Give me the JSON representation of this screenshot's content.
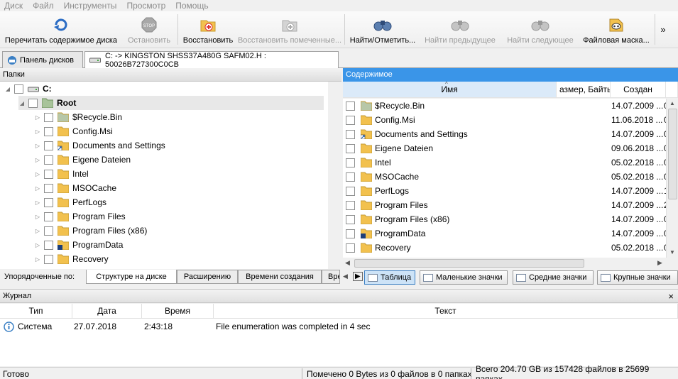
{
  "menu": [
    "Диск",
    "Файл",
    "Инструменты",
    "Просмотр",
    "Помощь"
  ],
  "toolbar": {
    "rescan": "Перечитать содержимое диска",
    "stop": "Остановить",
    "restore": "Восстановить",
    "restore_marked": "Восстановить помеченные...",
    "find_mark": "Найти/Отметить...",
    "find_prev": "Найти предыдущее",
    "find_next": "Найти следующее",
    "file_mask": "Файловая маска...",
    "more": "»"
  },
  "tabs": {
    "panel": "Панель дисков",
    "drive": "C: -> KINGSTON SHSS37A480G SAFM02.H : 50026B727300C0CB"
  },
  "left": {
    "header": "Папки",
    "drive": "C:",
    "root": "Root",
    "folders": [
      "$Recycle.Bin",
      "Config.Msi",
      "Documents and Settings",
      "Eigene Dateien",
      "Intel",
      "MSOCache",
      "PerfLogs",
      "Program Files",
      "Program Files (x86)",
      "ProgramData",
      "Recovery"
    ]
  },
  "right": {
    "header": "Содержимое",
    "columns": {
      "name": "Имя",
      "size": "азмер, Байты",
      "created": "Создан"
    },
    "rows": [
      {
        "name": "$Recycle.Bin",
        "date": "14.07.2009 ...",
        "x": "0"
      },
      {
        "name": "Config.Msi",
        "date": "11.06.2018 ...",
        "x": "0"
      },
      {
        "name": "Documents and Settings",
        "date": "14.07.2009 ...",
        "x": "0"
      },
      {
        "name": "Eigene Dateien",
        "date": "09.06.2018 ...",
        "x": "0"
      },
      {
        "name": "Intel",
        "date": "05.02.2018 ...",
        "x": "0"
      },
      {
        "name": "MSOCache",
        "date": "05.02.2018 ...",
        "x": "0"
      },
      {
        "name": "PerfLogs",
        "date": "14.07.2009 ...",
        "x": "1"
      },
      {
        "name": "Program Files",
        "date": "14.07.2009 ...",
        "x": "2"
      },
      {
        "name": "Program Files (x86)",
        "date": "14.07.2009 ...",
        "x": "0"
      },
      {
        "name": "ProgramData",
        "date": "14.07.2009 ...",
        "x": "0"
      },
      {
        "name": "Recovery",
        "date": "05.02.2018 ...",
        "x": "0"
      }
    ]
  },
  "sort": {
    "label": "Упорядоченные по:",
    "tabs": [
      "Структуре на диске",
      "Расширению",
      "Времени создания",
      "Вре"
    ]
  },
  "views": {
    "table": "Таблица",
    "small": "Маленькие значки",
    "medium": "Средние значки",
    "large": "Крупные значки"
  },
  "log": {
    "header": "Журнал",
    "close": "×",
    "columns": {
      "type": "Тип",
      "date": "Дата",
      "time": "Время",
      "text": "Текст"
    },
    "entry": {
      "type": "Система",
      "date": "27.07.2018",
      "time": "2:43:18",
      "text": "File enumeration was completed in 4 sec"
    }
  },
  "status": {
    "ready": "Готово",
    "marked": "Помечено 0 Bytes из 0 файлов в 0 папках",
    "total": "Всего 204.70 GB из 157428 файлов в 25699 папках"
  },
  "colors": {
    "accent": "#3a95e8",
    "folder": "#f2c14e"
  }
}
